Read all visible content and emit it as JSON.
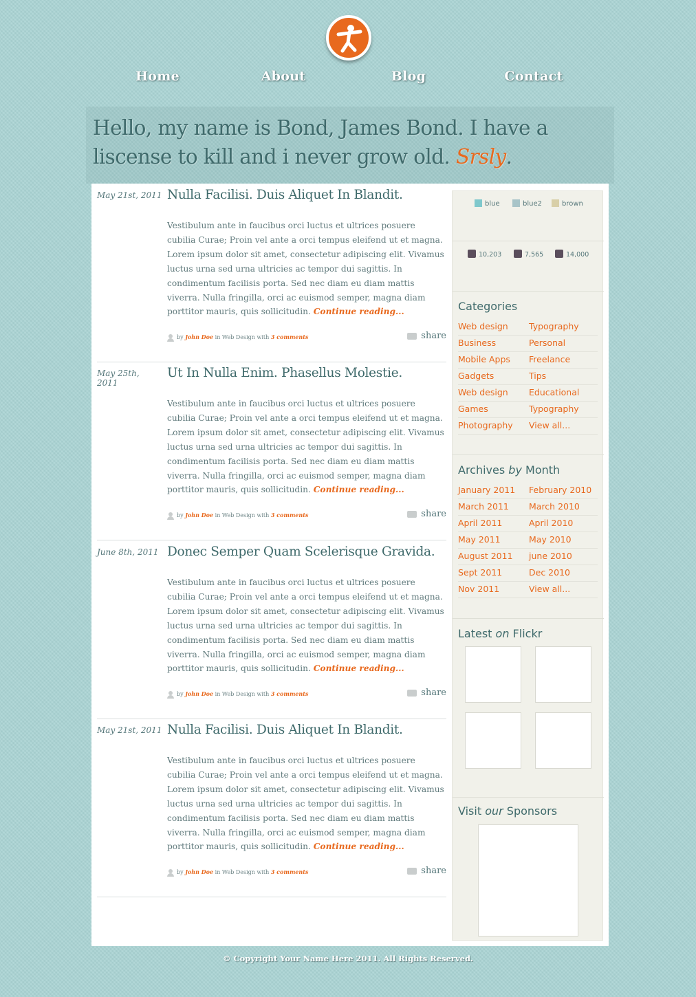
{
  "nav": {
    "home": "Home",
    "about": "About",
    "blog": "Blog",
    "contact": "Contact"
  },
  "hero": {
    "text_main": "Hello, my name is Bond, James Bond. I have a liscense to kill and i never grow old. ",
    "text_em": "Srsly",
    "text_end": "."
  },
  "posts": [
    {
      "date": "May 21st, 2011",
      "title": "Nulla Facilisi. Duis Aliquet In Blandit.",
      "body": "Vestibulum ante in faucibus orci luctus et ultrices posuere cubilia Curae; Proin vel ante a orci tempus eleifend ut et magna. Lorem ipsum dolor sit amet, consectetur adipiscing elit. Vivamus luctus urna sed urna ultricies ac tempor dui sagittis. In condimentum facilisis porta. Sed nec diam eu diam mattis viverra. Nulla fringilla, orci ac euismod semper, magna diam porttitor mauris, quis sollicitudin. ",
      "more": "Continue reading...",
      "by": "by",
      "author": "John Doe",
      "in": "in Web Design with",
      "comments": "3 comments",
      "share": "share"
    },
    {
      "date": "May 25th, 2011",
      "title": "Ut In Nulla Enim. Phasellus Molestie.",
      "body": "Vestibulum ante in faucibus orci luctus et ultrices posuere cubilia Curae; Proin vel ante a orci tempus eleifend ut et magna. Lorem ipsum dolor sit amet, consectetur adipiscing elit. Vivamus luctus urna sed urna ultricies ac tempor dui sagittis. In condimentum facilisis porta. Sed nec diam eu diam mattis viverra. Nulla fringilla, orci ac euismod semper, magna diam porttitor mauris, quis sollicitudin. ",
      "more": "Continue reading...",
      "by": "by",
      "author": "John Doe",
      "in": "in Web Design with",
      "comments": "3 comments",
      "share": "share"
    },
    {
      "date": "June 8th, 2011",
      "title": "Donec Semper Quam Scelerisque Gravida.",
      "body": "Vestibulum ante in faucibus orci luctus et ultrices posuere cubilia Curae; Proin vel ante a orci tempus eleifend ut et magna. Lorem ipsum dolor sit amet, consectetur adipiscing elit. Vivamus luctus urna sed urna ultricies ac tempor dui sagittis. In condimentum facilisis porta. Sed nec diam eu diam mattis viverra. Nulla fringilla, orci ac euismod semper, magna diam porttitor mauris, quis sollicitudin. ",
      "more": "Continue reading...",
      "by": "by",
      "author": "John Doe",
      "in": "in Web Design with",
      "comments": "3 comments",
      "share": "share"
    },
    {
      "date": "May 21st, 2011",
      "title": "Nulla Facilisi. Duis Aliquet In Blandit.",
      "body": "Vestibulum ante in faucibus orci luctus et ultrices posuere cubilia Curae; Proin vel ante a orci tempus eleifend ut et magna. Lorem ipsum dolor sit amet, consectetur adipiscing elit. Vivamus luctus urna sed urna ultricies ac tempor dui sagittis. In condimentum facilisis porta. Sed nec diam eu diam mattis viverra. Nulla fringilla, orci ac euismod semper, magna diam porttitor mauris, quis sollicitudin. ",
      "more": "Continue reading...",
      "by": "by",
      "author": "John Doe",
      "in": "in Web Design with",
      "comments": "3 comments",
      "share": "share"
    }
  ],
  "themes": [
    {
      "label": "blue",
      "color": "#7fc8cc"
    },
    {
      "label": "blue2",
      "color": "#a8c4c8"
    },
    {
      "label": "brown",
      "color": "#d8cfa8"
    }
  ],
  "stats": {
    "rss": "10,203",
    "twitter": "7,565",
    "facebook": "14,000"
  },
  "categories": {
    "title": "Categories",
    "left": [
      "Web design",
      "Business",
      "Mobile Apps",
      "Gadgets",
      "Web design",
      "Games",
      "Photography"
    ],
    "right": [
      "Typography",
      "Personal",
      "Freelance",
      "Tips",
      "Educational",
      "Typography",
      "View all..."
    ]
  },
  "archives": {
    "title_a": "Archives ",
    "title_em": "by",
    "title_b": " Month",
    "left": [
      "January 2011",
      "March 2011",
      "April 2011",
      "May 2011",
      "August 2011",
      "Sept 2011",
      "Nov 2011"
    ],
    "right": [
      "February 2010",
      "March 2010",
      "April 2010",
      "May 2010",
      "june 2010",
      "Dec 2010",
      "View all..."
    ]
  },
  "flickr": {
    "title_a": "Latest ",
    "title_em": "on",
    "title_b": " Flickr"
  },
  "sponsors": {
    "title_a": "Visit ",
    "title_em": "our",
    "title_b": " Sponsors"
  },
  "footer": "© Copyright Your Name Here 2011. All Rights Reserved.",
  "colors": {
    "accent": "#e8691e",
    "heading": "#3f6a6b",
    "background": "#a9d3d3"
  }
}
